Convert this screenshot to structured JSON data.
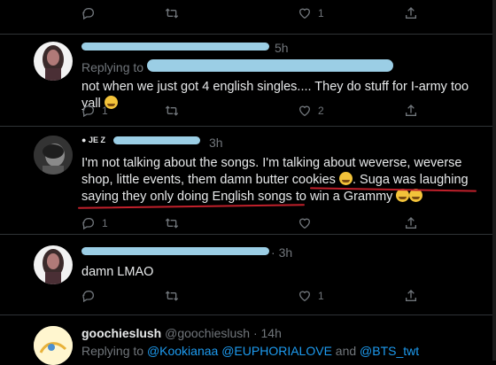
{
  "tweets": [
    {
      "time": "",
      "actions": {
        "reply": "",
        "retweet": "",
        "like": "1",
        "share": ""
      }
    },
    {
      "time": "5h",
      "replying_prefix": "Replying to",
      "body": "not when we just got 4 english singles.... They do stuff for I-army too yall",
      "emoji": "sad-emoji",
      "actions": {
        "reply": "1",
        "retweet": "",
        "like": "2",
        "share": ""
      }
    },
    {
      "name_fragment": "JE Z",
      "time": "3h",
      "body_plain": "I'm not talking about the songs. I'm talking about weverse, weverse shop, little events, them damn butter cookies",
      "body_underlined_1": "Suga was laughing saying they",
      "body_underlined_2": "only doing English songs to win a Grammy",
      "actions": {
        "reply": "1",
        "retweet": "",
        "like": "",
        "share": ""
      }
    },
    {
      "time": "3h",
      "body": "damn LMAO",
      "actions": {
        "reply": "",
        "retweet": "",
        "like": "1",
        "share": ""
      }
    },
    {
      "name": "goochieslush",
      "handle": "@goochieslush",
      "time": "14h",
      "replying_prefix": "Replying to",
      "mentions": [
        "@Kookianaa",
        "@EUPHORIALOVE",
        "@BTS_twt"
      ],
      "and_word": "and"
    }
  ],
  "colors": {
    "link": "#1d9bf0",
    "muted": "#71767b",
    "scribble": "#a8e0f8",
    "annotation": "#c0202b"
  }
}
